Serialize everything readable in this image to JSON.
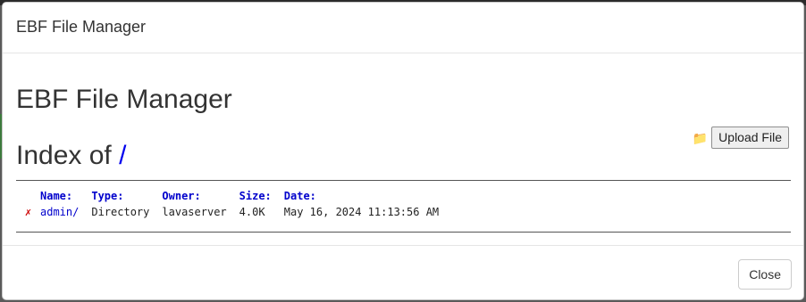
{
  "modal": {
    "title": "EBF File Manager",
    "close_label": "Close"
  },
  "page": {
    "heading": "EBF File Manager",
    "index_prefix": "Index of",
    "index_path": "/",
    "upload_label": "Upload File",
    "folder_icon": "folder-icon"
  },
  "listing": {
    "headers": {
      "name": "Name:",
      "type": "Type:",
      "owner": "Owner:",
      "size": "Size:",
      "date": "Date:"
    },
    "rows": [
      {
        "delete_glyph": "✗",
        "name": "admin/",
        "type": "Directory",
        "owner": "lavaserver",
        "size": "4.0K",
        "date": "May 16, 2024 11:13:56 AM"
      }
    ]
  },
  "colors": {
    "link": "#0000cc",
    "delete": "#cc0000",
    "heading": "#333333"
  }
}
